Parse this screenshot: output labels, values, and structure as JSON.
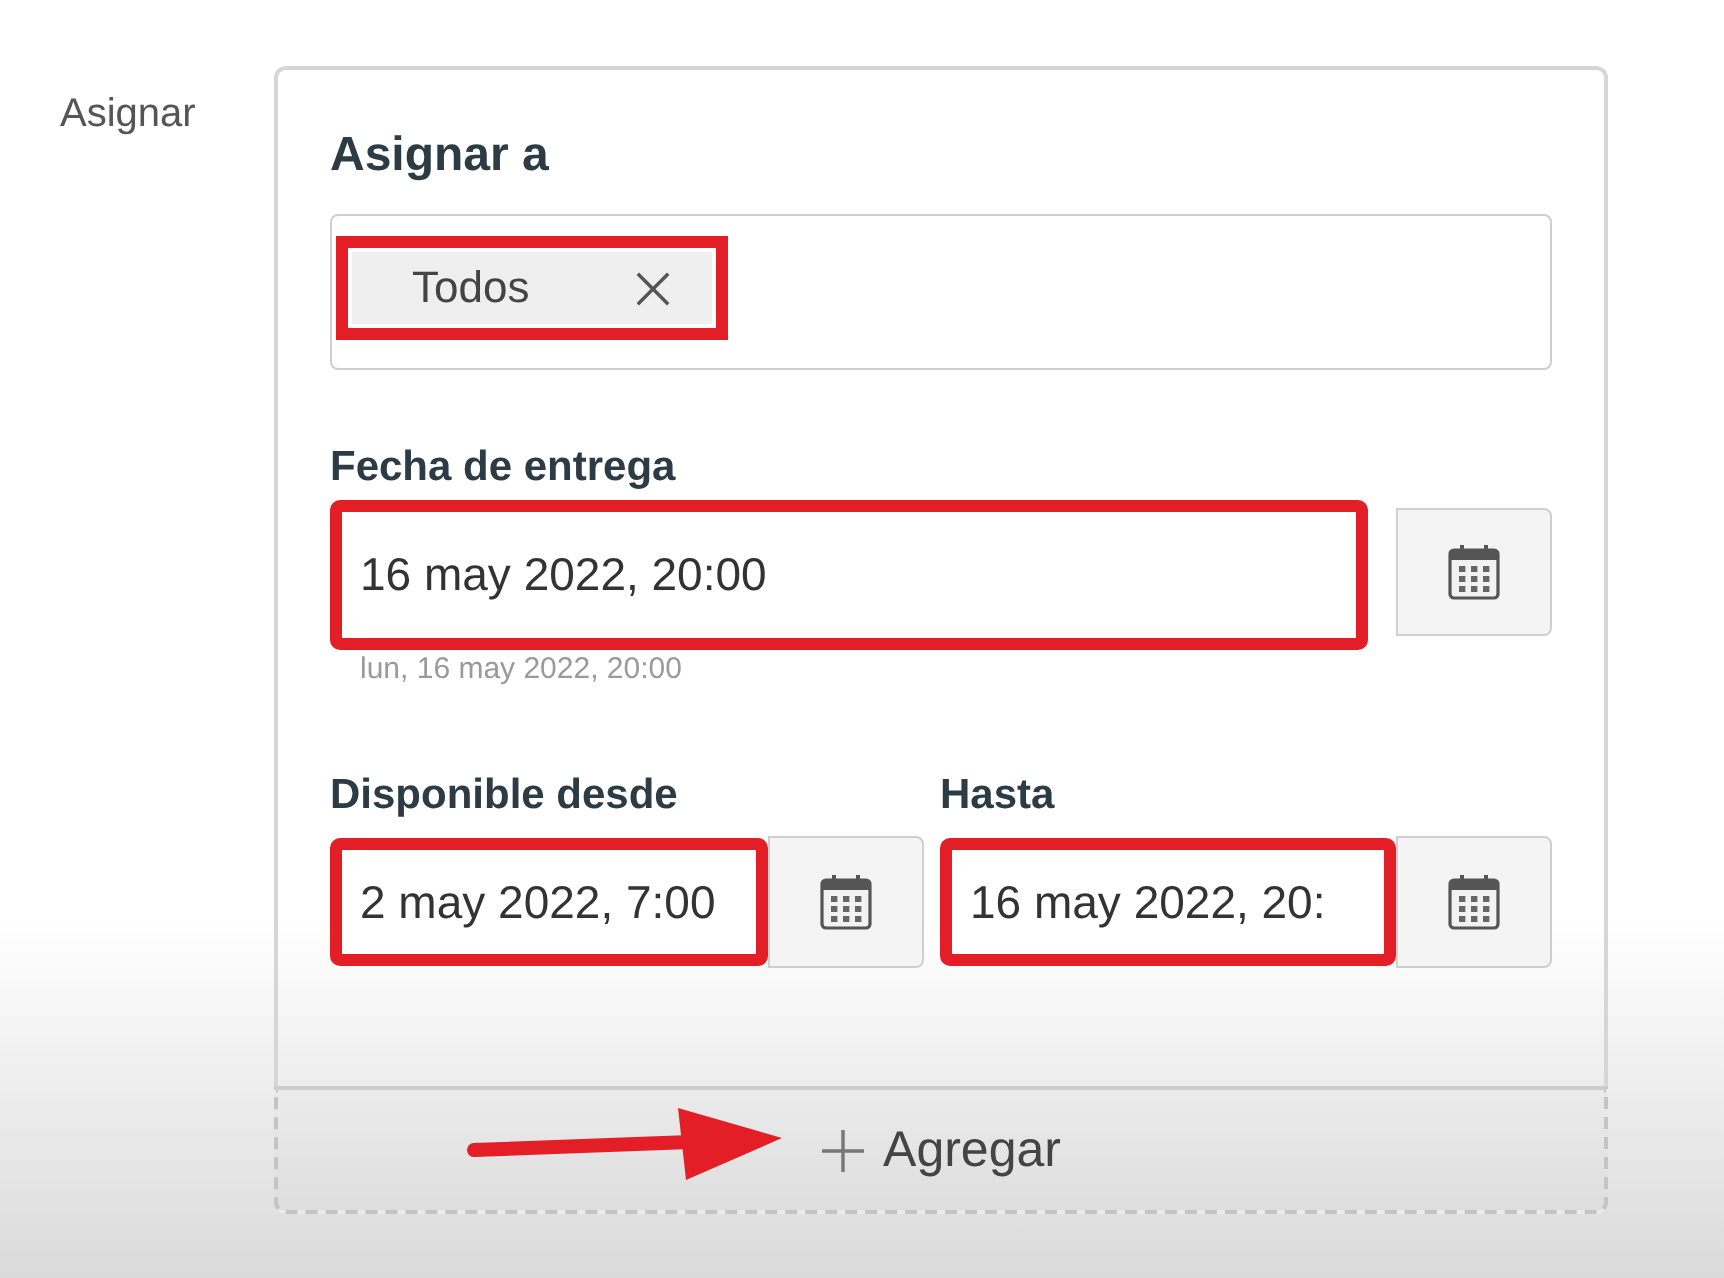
{
  "side_label": "Asignar",
  "assign_card": {
    "heading": "Asignar a",
    "assignees": [
      {
        "label": "Todos",
        "highlighted": true
      }
    ],
    "due_date": {
      "label": "Fecha de entrega",
      "value": "16 may 2022, 20:00",
      "hint": "lun, 16 may 2022, 20:00",
      "highlighted": true
    },
    "availability": [
      {
        "label": "Disponible desde",
        "value": "2 may 2022, 7:00",
        "highlighted": true
      },
      {
        "label": "Hasta",
        "value": "16 may 2022, 20:",
        "highlighted": true
      }
    ]
  },
  "add_button": {
    "label": "Agregar",
    "arrow": true
  }
}
